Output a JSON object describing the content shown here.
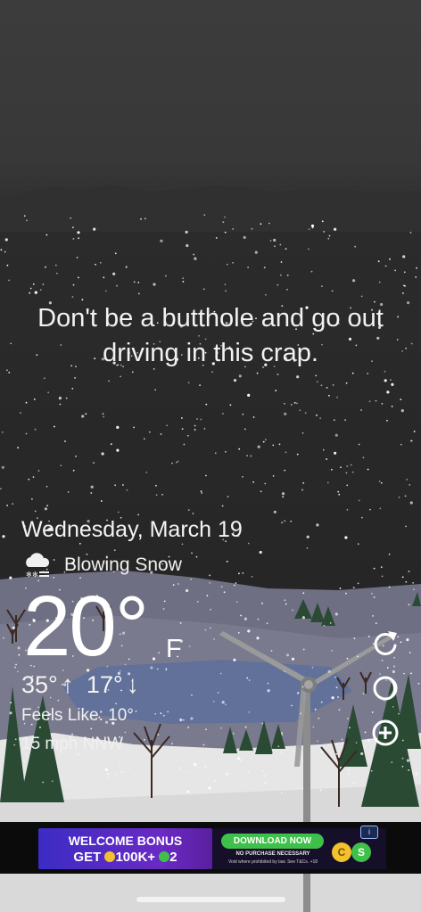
{
  "message": "Don't be a butthole and go out driving in this crap.",
  "weather": {
    "date": "Wednesday, March 19",
    "condition": "Blowing Snow",
    "condition_icon": "cloud-snow-icon",
    "temperature": "20°",
    "unit": "F",
    "high": "35°",
    "low": "17°",
    "feels_like": "Feels Like: 10°",
    "wind": "15 mph NNW"
  },
  "controls": {
    "refresh_icon": "refresh-icon",
    "theme_icon": "moon-icon",
    "add_icon": "plus-circle-icon"
  },
  "ad": {
    "headline": "WELCOME BONUS",
    "offer_prefix": "GET",
    "offer_main": "100K+",
    "offer_suffix": "2",
    "cta": "DOWNLOAD NOW",
    "disclaimer": "NO PURCHASE NECESSARY",
    "fine_print": "Void where prohibited by law. See T&Cs. +18",
    "badge": "i",
    "coin_gold": "C",
    "coin_green": "S",
    "colors": {
      "left_bg": "#5a2ac4",
      "cta_bg": "#3fc04a"
    }
  }
}
